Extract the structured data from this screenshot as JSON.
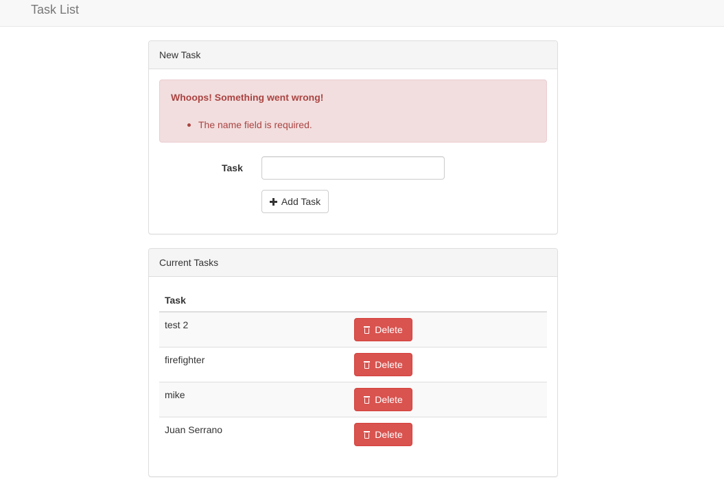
{
  "navbar": {
    "brand": "Task List"
  },
  "new_task_panel": {
    "heading": "New Task",
    "alert": {
      "title": "Whoops! Something went wrong!",
      "errors": [
        "The name field is required."
      ]
    },
    "form": {
      "task_label": "Task",
      "task_value": "",
      "add_button_label": "Add Task"
    }
  },
  "current_tasks_panel": {
    "heading": "Current Tasks",
    "table": {
      "column_header": "Task",
      "rows": [
        {
          "name": "test 2",
          "delete_label": "Delete"
        },
        {
          "name": "firefighter",
          "delete_label": "Delete"
        },
        {
          "name": "mike",
          "delete_label": "Delete"
        },
        {
          "name": "Juan Serrano",
          "delete_label": "Delete"
        }
      ]
    }
  },
  "colors": {
    "danger": "#d9534f",
    "alert_bg": "#f2dede",
    "alert_text": "#a94442",
    "navbar_bg": "#f8f8f8"
  },
  "icons": {
    "add": "plus-icon",
    "delete": "trash-icon"
  }
}
